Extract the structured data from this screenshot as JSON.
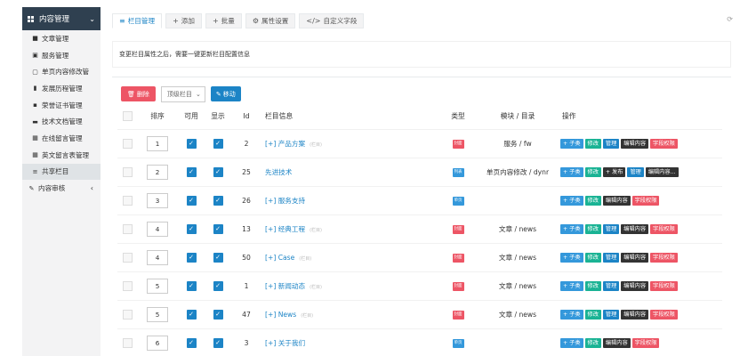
{
  "sidebar": {
    "header": "内容管理",
    "items": [
      {
        "label": "文章管理",
        "icon": "■"
      },
      {
        "label": "服务管理",
        "icon": "▣"
      },
      {
        "label": "单页内容修改管",
        "icon": "▢"
      },
      {
        "label": "发展历程管理",
        "icon": "▮"
      },
      {
        "label": "荣誉证书管理",
        "icon": "▪"
      },
      {
        "label": "技术文档管理",
        "icon": "▬"
      },
      {
        "label": "在线留言管理",
        "icon": "▦"
      },
      {
        "label": "英文留言表管理",
        "icon": "▦"
      },
      {
        "label": "共享栏目",
        "icon": "≡"
      }
    ],
    "group2": "内容审核"
  },
  "tabs": [
    {
      "label": "栏目管理",
      "icon": "≡"
    },
    {
      "label": "添加",
      "icon": "+"
    },
    {
      "label": "批量",
      "icon": "+"
    },
    {
      "label": "属性设置",
      "icon": "⚙"
    },
    {
      "label": "自定义字段",
      "icon": "</>"
    }
  ],
  "notice": "变更栏目属性之后，需要一键更新栏目配置信息",
  "toolbar": {
    "delete": "删除",
    "select": "顶级栏目",
    "move": "移动"
  },
  "columns": [
    "排序",
    "可用",
    "显示",
    "Id",
    "栏目信息",
    "类型",
    "模块 / 目录",
    "操作"
  ],
  "colors": {
    "blue": "#3498db",
    "green": "#1ab394",
    "dark": "#333333",
    "red": "#ed5565",
    "accent": "#1c84c6"
  },
  "rows": [
    {
      "order": "1",
      "id": "2",
      "name": "[+] 产品方案",
      "sub": "(栏目)",
      "type": "封面",
      "type_color": "#ed5565",
      "module": "服务 / fw",
      "ops": [
        {
          "t": "+ 子类",
          "c": "blue"
        },
        {
          "t": "修改",
          "c": "green"
        },
        {
          "t": "管理",
          "c": "navy"
        },
        {
          "t": "编辑内容",
          "c": "dark"
        },
        {
          "t": "字段权限",
          "c": "red"
        }
      ]
    },
    {
      "order": "2",
      "id": "25",
      "name": "先进技术",
      "sub": "",
      "type": "列表",
      "type_color": "#3498db",
      "module": "单页内容修改 / dynr",
      "ops": [
        {
          "t": "+ 子类",
          "c": "blue"
        },
        {
          "t": "修改",
          "c": "green"
        },
        {
          "t": "+ 发布",
          "c": "dark"
        },
        {
          "t": "管理",
          "c": "navy"
        },
        {
          "t": "编辑内容…",
          "c": "dark"
        }
      ]
    },
    {
      "order": "3",
      "id": "26",
      "name": "[+] 服务支持",
      "sub": "",
      "type": "单页",
      "type_color": "#3498db",
      "module": "",
      "ops": [
        {
          "t": "+ 子类",
          "c": "blue"
        },
        {
          "t": "修改",
          "c": "green"
        },
        {
          "t": "编辑内容",
          "c": "dark"
        },
        {
          "t": "字段权限",
          "c": "red"
        }
      ]
    },
    {
      "order": "4",
      "id": "13",
      "name": "[+] 经典工程",
      "sub": "(栏目)",
      "type": "封面",
      "type_color": "#ed5565",
      "module": "文章 / news",
      "ops": [
        {
          "t": "+ 子类",
          "c": "blue"
        },
        {
          "t": "修改",
          "c": "green"
        },
        {
          "t": "管理",
          "c": "navy"
        },
        {
          "t": "编辑内容",
          "c": "dark"
        },
        {
          "t": "字段权限",
          "c": "red"
        }
      ]
    },
    {
      "order": "4",
      "id": "50",
      "name": "[+] Case",
      "sub": "(栏目)",
      "type": "封面",
      "type_color": "#ed5565",
      "module": "文章 / news",
      "ops": [
        {
          "t": "+ 子类",
          "c": "blue"
        },
        {
          "t": "修改",
          "c": "green"
        },
        {
          "t": "管理",
          "c": "navy"
        },
        {
          "t": "编辑内容",
          "c": "dark"
        },
        {
          "t": "字段权限",
          "c": "red"
        }
      ]
    },
    {
      "order": "5",
      "id": "1",
      "name": "[+] 新闻动态",
      "sub": "(栏目)",
      "type": "封面",
      "type_color": "#ed5565",
      "module": "文章 / news",
      "ops": [
        {
          "t": "+ 子类",
          "c": "blue"
        },
        {
          "t": "修改",
          "c": "green"
        },
        {
          "t": "管理",
          "c": "navy"
        },
        {
          "t": "编辑内容",
          "c": "dark"
        },
        {
          "t": "字段权限",
          "c": "red"
        }
      ]
    },
    {
      "order": "5",
      "id": "47",
      "name": "[+] News",
      "sub": "(栏目)",
      "type": "封面",
      "type_color": "#ed5565",
      "module": "文章 / news",
      "ops": [
        {
          "t": "+ 子类",
          "c": "blue"
        },
        {
          "t": "修改",
          "c": "green"
        },
        {
          "t": "管理",
          "c": "navy"
        },
        {
          "t": "编辑内容",
          "c": "dark"
        },
        {
          "t": "字段权限",
          "c": "red"
        }
      ]
    },
    {
      "order": "6",
      "id": "3",
      "name": "[+] 关于我们",
      "sub": "",
      "type": "单页",
      "type_color": "#3498db",
      "module": "",
      "ops": [
        {
          "t": "+ 子类",
          "c": "blue"
        },
        {
          "t": "修改",
          "c": "green"
        },
        {
          "t": "编辑内容",
          "c": "dark"
        },
        {
          "t": "字段权限",
          "c": "red"
        }
      ]
    }
  ]
}
